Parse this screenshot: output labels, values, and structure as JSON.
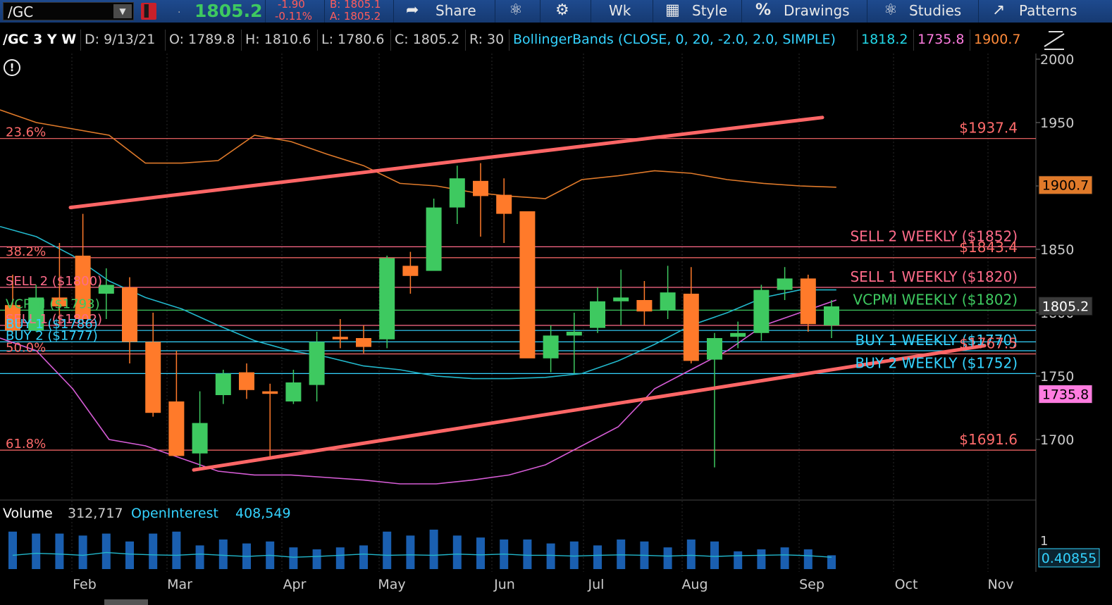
{
  "toolbar": {
    "symbol": "/GC",
    "last": "1805.2",
    "net_change": "-1.90",
    "pct_change": "-0.11%",
    "bid": "B: 1805.1",
    "ask": "A: 1805.2",
    "share": "Share",
    "aggregation": "Wk",
    "style": "Style",
    "drawings": "Drawings",
    "studies": "Studies",
    "patterns": "Patterns"
  },
  "info": {
    "title": "/GC 3 Y W",
    "date": "D: 9/13/21",
    "open": "O: 1789.8",
    "high": "H: 1810.6",
    "low": "L: 1780.6",
    "close": "C: 1805.2",
    "range": "R: 30",
    "study": "BollingerBands (CLOSE, 0, 20, -2.0, 2.0, SIMPLE)",
    "bb_mid": "1818.2",
    "bb_low": "1735.8",
    "bb_up": "1900.7"
  },
  "volume": {
    "label": "Volume",
    "value": "312,717",
    "oi_label": "OpenInterest",
    "oi_value": "408,549",
    "axis_top": "1",
    "readout": "0.40855"
  },
  "colors": {
    "up": "#3ec960",
    "down": "#ff7a2a",
    "fib": "#ff6b6b",
    "sell": "#ff6b8a",
    "vcpmi": "#3ec960",
    "buy": "#34d3ff",
    "trend": "#ff6666",
    "bb_upper": "#e07a2a",
    "bb_mid": "#22b8cc",
    "bb_lower": "#d65cd6",
    "volume": "#1a5fb0"
  },
  "chart_data": {
    "type": "candlestick",
    "ylim": [
      1655,
      2005
    ],
    "yticks": [
      2000,
      1950,
      1900,
      1850,
      1800,
      1750,
      1700
    ],
    "months": [
      "Feb",
      "Mar",
      "Apr",
      "May",
      "Jun",
      "Jul",
      "Aug",
      "Sep",
      "Oct",
      "Nov"
    ],
    "candles": [
      {
        "o": 1806,
        "h": 1830,
        "l": 1785,
        "c": 1786
      },
      {
        "o": 1786,
        "h": 1822,
        "l": 1785,
        "c": 1812
      },
      {
        "o": 1812,
        "h": 1855,
        "l": 1790,
        "c": 1805
      },
      {
        "o": 1845,
        "h": 1878,
        "l": 1790,
        "c": 1795
      },
      {
        "o": 1815,
        "h": 1835,
        "l": 1795,
        "c": 1822
      },
      {
        "o": 1820,
        "h": 1828,
        "l": 1760,
        "c": 1777
      },
      {
        "o": 1777,
        "h": 1800,
        "l": 1718,
        "c": 1721
      },
      {
        "o": 1730,
        "h": 1770,
        "l": 1688,
        "c": 1687
      },
      {
        "o": 1689,
        "h": 1738,
        "l": 1678,
        "c": 1713
      },
      {
        "o": 1735,
        "h": 1755,
        "l": 1728,
        "c": 1752
      },
      {
        "o": 1753,
        "h": 1760,
        "l": 1732,
        "c": 1739
      },
      {
        "o": 1738,
        "h": 1744,
        "l": 1685,
        "c": 1736
      },
      {
        "o": 1730,
        "h": 1755,
        "l": 1728,
        "c": 1745
      },
      {
        "o": 1743,
        "h": 1785,
        "l": 1730,
        "c": 1777
      },
      {
        "o": 1781,
        "h": 1795,
        "l": 1772,
        "c": 1779
      },
      {
        "o": 1780,
        "h": 1790,
        "l": 1768,
        "c": 1773
      },
      {
        "o": 1779,
        "h": 1845,
        "l": 1772,
        "c": 1843
      },
      {
        "o": 1837,
        "h": 1848,
        "l": 1815,
        "c": 1829
      },
      {
        "o": 1833,
        "h": 1890,
        "l": 1840,
        "c": 1883
      },
      {
        "o": 1883,
        "h": 1916,
        "l": 1870,
        "c": 1906
      },
      {
        "o": 1904,
        "h": 1918,
        "l": 1860,
        "c": 1892
      },
      {
        "o": 1893,
        "h": 1906,
        "l": 1855,
        "c": 1878
      },
      {
        "o": 1880,
        "h": 1879,
        "l": 1765,
        "c": 1764
      },
      {
        "o": 1764,
        "h": 1790,
        "l": 1753,
        "c": 1782
      },
      {
        "o": 1782,
        "h": 1800,
        "l": 1752,
        "c": 1785
      },
      {
        "o": 1788,
        "h": 1820,
        "l": 1784,
        "c": 1809
      },
      {
        "o": 1809,
        "h": 1834,
        "l": 1790,
        "c": 1812
      },
      {
        "o": 1810,
        "h": 1825,
        "l": 1790,
        "c": 1801
      },
      {
        "o": 1802,
        "h": 1837,
        "l": 1795,
        "c": 1816
      },
      {
        "o": 1815,
        "h": 1836,
        "l": 1760,
        "c": 1762
      },
      {
        "o": 1763,
        "h": 1784,
        "l": 1678,
        "c": 1780
      },
      {
        "o": 1781,
        "h": 1793,
        "l": 1772,
        "c": 1784
      },
      {
        "o": 1784,
        "h": 1822,
        "l": 1778,
        "c": 1818
      },
      {
        "o": 1818,
        "h": 1836,
        "l": 1810,
        "c": 1827
      },
      {
        "o": 1827,
        "h": 1830,
        "l": 1785,
        "c": 1791
      },
      {
        "o": 1790,
        "h": 1810,
        "l": 1780,
        "c": 1805
      }
    ],
    "bb_upper": [
      1960,
      1950,
      1945,
      1940,
      1918,
      1918,
      1920,
      1940,
      1935,
      1925,
      1916,
      1902,
      1900,
      1895,
      1892,
      1890,
      1905,
      1908,
      1912,
      1910,
      1905,
      1902,
      1900,
      1899
    ],
    "bb_mid": [
      1868,
      1860,
      1845,
      1825,
      1812,
      1803,
      1790,
      1778,
      1770,
      1765,
      1758,
      1755,
      1750,
      1748,
      1748,
      1749,
      1752,
      1762,
      1775,
      1790,
      1800,
      1812,
      1818,
      1818
    ],
    "bb_lower": [
      1780,
      1770,
      1740,
      1700,
      1695,
      1685,
      1675,
      1672,
      1672,
      1670,
      1668,
      1665,
      1665,
      1668,
      1672,
      1680,
      1695,
      1710,
      1740,
      1755,
      1770,
      1790,
      1800,
      1810
    ],
    "levels": [
      {
        "price": 1937.4,
        "left": "23.6%",
        "right": "$1937.4",
        "kind": "fib"
      },
      {
        "price": 1852,
        "right": "SELL 2 WEEKLY ($1852)",
        "kind": "sell"
      },
      {
        "price": 1843.4,
        "left": "38.2%",
        "right": "$1843.4",
        "kind": "fib"
      },
      {
        "price": 1820,
        "left": "SELL 2 ($1800)",
        "right": "SELL 1 WEEKLY ($1820)",
        "kind": "sell"
      },
      {
        "price": 1802,
        "left": "VCPMI ($1793)",
        "right": "VCPMI WEEKLY ($1802)",
        "kind": "vcpmi"
      },
      {
        "price": 1790,
        "left": "SELL 1 ($1802)",
        "kind": "sell"
      },
      {
        "price": 1786,
        "left": "BUY 1 ($1786)",
        "kind": "buy"
      },
      {
        "price": 1777,
        "left": "BUY 2 ($1777)",
        "kind": "buy"
      },
      {
        "price": 1770,
        "right": "BUY 1 WEEKLY ($1770)",
        "kind": "buy"
      },
      {
        "price": 1767.5,
        "left": "50.0%",
        "right": "$1767.5",
        "kind": "fib"
      },
      {
        "price": 1752,
        "right": "BUY 2 WEEKLY ($1752)",
        "kind": "buy"
      },
      {
        "price": 1691.6,
        "left": "61.8%",
        "right": "$1691.6",
        "kind": "fib"
      }
    ],
    "trendlines": [
      {
        "p1": [
          1883,
          1
        ],
        "p2": [
          1954,
          33
        ]
      },
      {
        "p1": [
          1676,
          8
        ],
        "p2": [
          1774,
          40
        ]
      }
    ],
    "price_tags": [
      {
        "price": 1900.7,
        "text": "1900.7",
        "bg": "#e07a2a",
        "fg": "#000"
      },
      {
        "price": 1805.2,
        "text": "1805.2",
        "bg": "#3a3a3a",
        "fg": "#fff"
      },
      {
        "price": 1735.8,
        "text": "1735.8",
        "bg": "#ff7ce0",
        "fg": "#000"
      }
    ],
    "volume": [
      0.95,
      0.9,
      0.9,
      0.85,
      0.9,
      0.7,
      0.9,
      0.95,
      0.6,
      0.75,
      0.65,
      0.7,
      0.55,
      0.5,
      0.55,
      0.6,
      0.95,
      0.85,
      1.0,
      0.85,
      0.8,
      0.75,
      0.75,
      0.65,
      0.7,
      0.6,
      0.75,
      0.7,
      0.55,
      0.75,
      0.7,
      0.45,
      0.5,
      0.55,
      0.5,
      0.35
    ],
    "open_interest": [
      0.35,
      0.4,
      0.38,
      0.35,
      0.42,
      0.38,
      0.36,
      0.35,
      0.38,
      0.35,
      0.32,
      0.35,
      0.3,
      0.32,
      0.35,
      0.38,
      0.35,
      0.36,
      0.35,
      0.38,
      0.36,
      0.38,
      0.35,
      0.35,
      0.33,
      0.35,
      0.36,
      0.35,
      0.33,
      0.35,
      0.32,
      0.34,
      0.35,
      0.36,
      0.34,
      0.3
    ]
  }
}
